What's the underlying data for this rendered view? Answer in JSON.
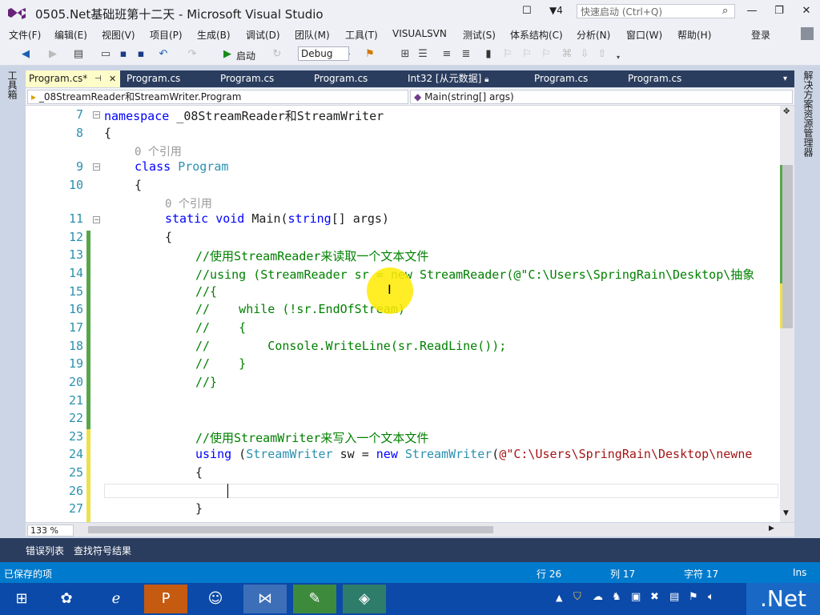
{
  "window": {
    "title": "0505.Net基础班第十二天 - Microsoft Visual Studio",
    "notification_count": "4",
    "quick_launch_placeholder": "快速启动 (Ctrl+Q)"
  },
  "menu": {
    "items": [
      "文件(F)",
      "编辑(E)",
      "视图(V)",
      "项目(P)",
      "生成(B)",
      "调试(D)",
      "团队(M)",
      "工具(T)",
      "VISUALSVN",
      "测试(S)",
      "体系结构(C)",
      "分析(N)",
      "窗口(W)",
      "帮助(H)"
    ],
    "login": "登录"
  },
  "toolbar": {
    "start_label": "启动",
    "configuration": "Debug"
  },
  "side_panels": {
    "left": "工具箱",
    "right": "解决方案资源管理器"
  },
  "tabs": [
    {
      "label": "Program.cs*",
      "active": true
    },
    {
      "label": "Program.cs"
    },
    {
      "label": "Program.cs"
    },
    {
      "label": "Program.cs"
    },
    {
      "label": "Int32 [从元数据]"
    },
    {
      "label": "Program.cs"
    },
    {
      "label": "Program.cs"
    }
  ],
  "navbar": {
    "type_selector": "_08StreamReader和StreamWriter.Program",
    "member_selector": "Main(string[] args)"
  },
  "editor": {
    "lines": [
      {
        "num": "7",
        "text": "namespace _08StreamReader和StreamWriter"
      },
      {
        "num": "8",
        "text": "{"
      },
      {
        "hint": "0 个引用"
      },
      {
        "num": "9",
        "text": "class Program"
      },
      {
        "num": "10",
        "text": "{"
      },
      {
        "hint": "0 个引用"
      },
      {
        "num": "11",
        "text": "static void Main(string[] args)"
      },
      {
        "num": "12",
        "text": "{"
      },
      {
        "num": "13",
        "text": "//使用StreamReader来读取一个文本文件"
      },
      {
        "num": "14",
        "text": "//using (StreamReader sr = new StreamReader(@\"C:\\Users\\SpringRain\\Desktop\\抽象"
      },
      {
        "num": "15",
        "text": "//{"
      },
      {
        "num": "16",
        "text": "//    while (!sr.EndOfStream)"
      },
      {
        "num": "17",
        "text": "//    {"
      },
      {
        "num": "18",
        "text": "//        Console.WriteLine(sr.ReadLine());"
      },
      {
        "num": "19",
        "text": "//    }"
      },
      {
        "num": "20",
        "text": "//}"
      },
      {
        "num": "21",
        "text": ""
      },
      {
        "num": "22",
        "text": ""
      },
      {
        "num": "23",
        "text": "//使用StreamWriter来写入一个文本文件"
      },
      {
        "num": "24",
        "text": "using (StreamWriter sw = new StreamWriter(@\"C:\\Users\\SpringRain\\Desktop\\newne"
      },
      {
        "num": "25",
        "text": "{"
      },
      {
        "num": "26",
        "text": ""
      },
      {
        "num": "27",
        "text": "}"
      }
    ],
    "zoom": "133 %"
  },
  "bottom_tabs": [
    "错误列表",
    "查找符号结果"
  ],
  "status": {
    "message": "已保存的项",
    "line": "行 26",
    "col": "列 17",
    "char": "字符 17",
    "mode": "Ins"
  },
  "taskbar": {
    "badge": ".Net"
  },
  "colors": {
    "accent": "#007acc",
    "tab_bar": "#2b3d5e",
    "active_tab": "#fefcc8"
  }
}
